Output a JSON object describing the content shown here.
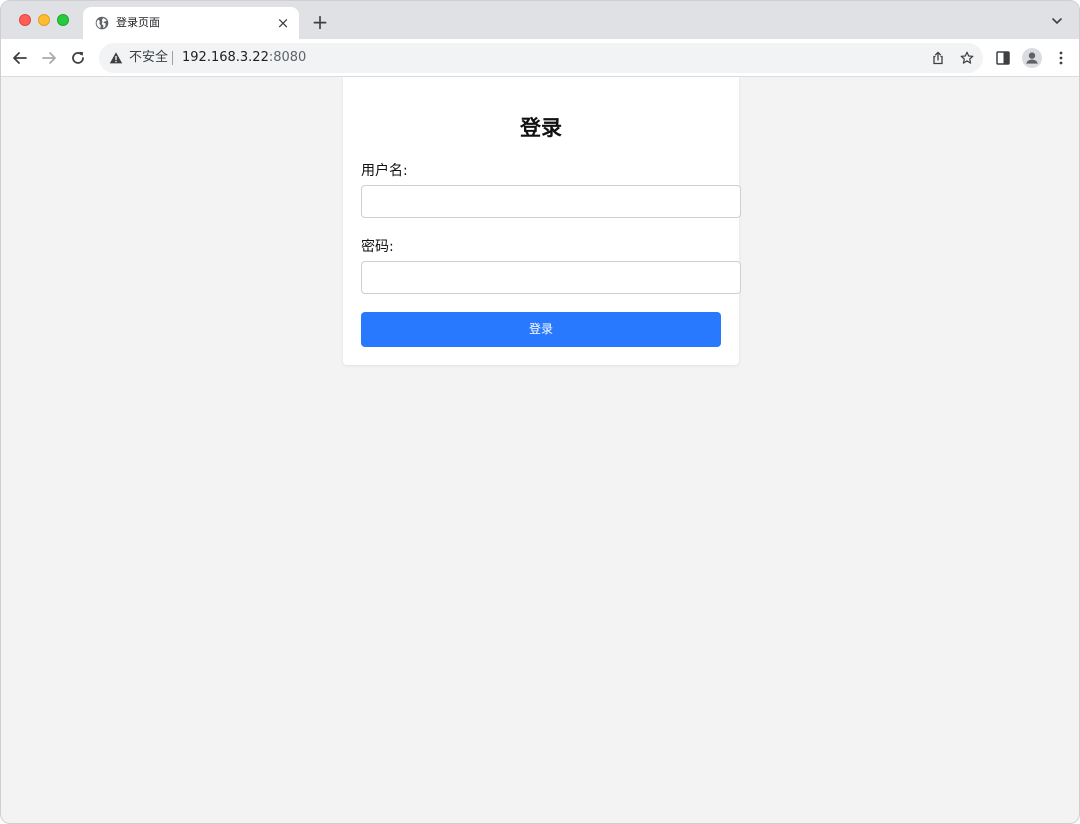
{
  "browser": {
    "tab": {
      "title": "登录页面",
      "close_label": "×"
    },
    "new_tab_label": "+",
    "omnibox": {
      "security_text": "不安全",
      "url_host": "192.168.3.22",
      "url_port": ":8080"
    },
    "icons": [
      "globe-icon",
      "close-icon",
      "plus-icon",
      "chevron-down-icon",
      "back-arrow-icon",
      "forward-arrow-icon",
      "reload-icon",
      "warning-icon",
      "share-icon",
      "star-icon",
      "side-panel-icon",
      "profile-icon",
      "kebab-menu-icon"
    ]
  },
  "login": {
    "title": "登录",
    "username_label": "用户名:",
    "username_value": "",
    "password_label": "密码:",
    "password_value": "",
    "submit_label": "登录",
    "accent_color": "#2979ff"
  }
}
